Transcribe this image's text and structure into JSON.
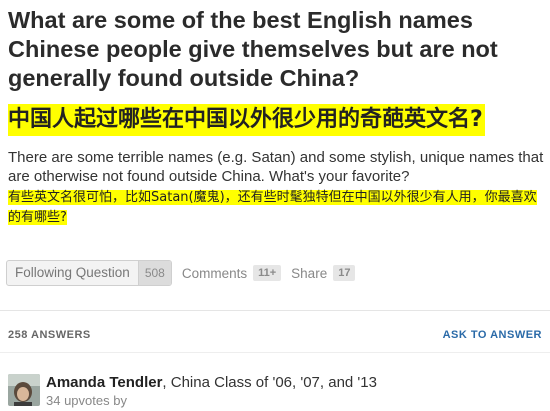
{
  "question": {
    "title_en": "What are some of the best English names Chinese people give themselves but are not generally found outside China?",
    "title_zh": "中国人起过哪些在中国以外很少用的奇葩英文名?",
    "body_en": "There are some terrible names (e.g. Satan) and some stylish, unique names that are otherwise not found outside China.  What's your favorite?",
    "body_zh": "有些英文名很可怕，比如Satan(魔鬼)，还有些时髦独特但在中国以外很少有人用，你最喜欢的有哪些?"
  },
  "actions": {
    "follow_label": "Following Question",
    "follow_count": "508",
    "comments_label": "Comments",
    "comments_count": "11+",
    "share_label": "Share",
    "share_count": "17"
  },
  "answers": {
    "count_label": "258 ANSWERS",
    "ask_label": "ASK TO ANSWER"
  },
  "answer": {
    "author_name": "Amanda Tendler",
    "author_credential": ", China Class of '06, '07, and '13",
    "upvotes": "34 upvotes by"
  },
  "colors": {
    "highlight": "#ffff00",
    "link": "#2a6aa8"
  }
}
